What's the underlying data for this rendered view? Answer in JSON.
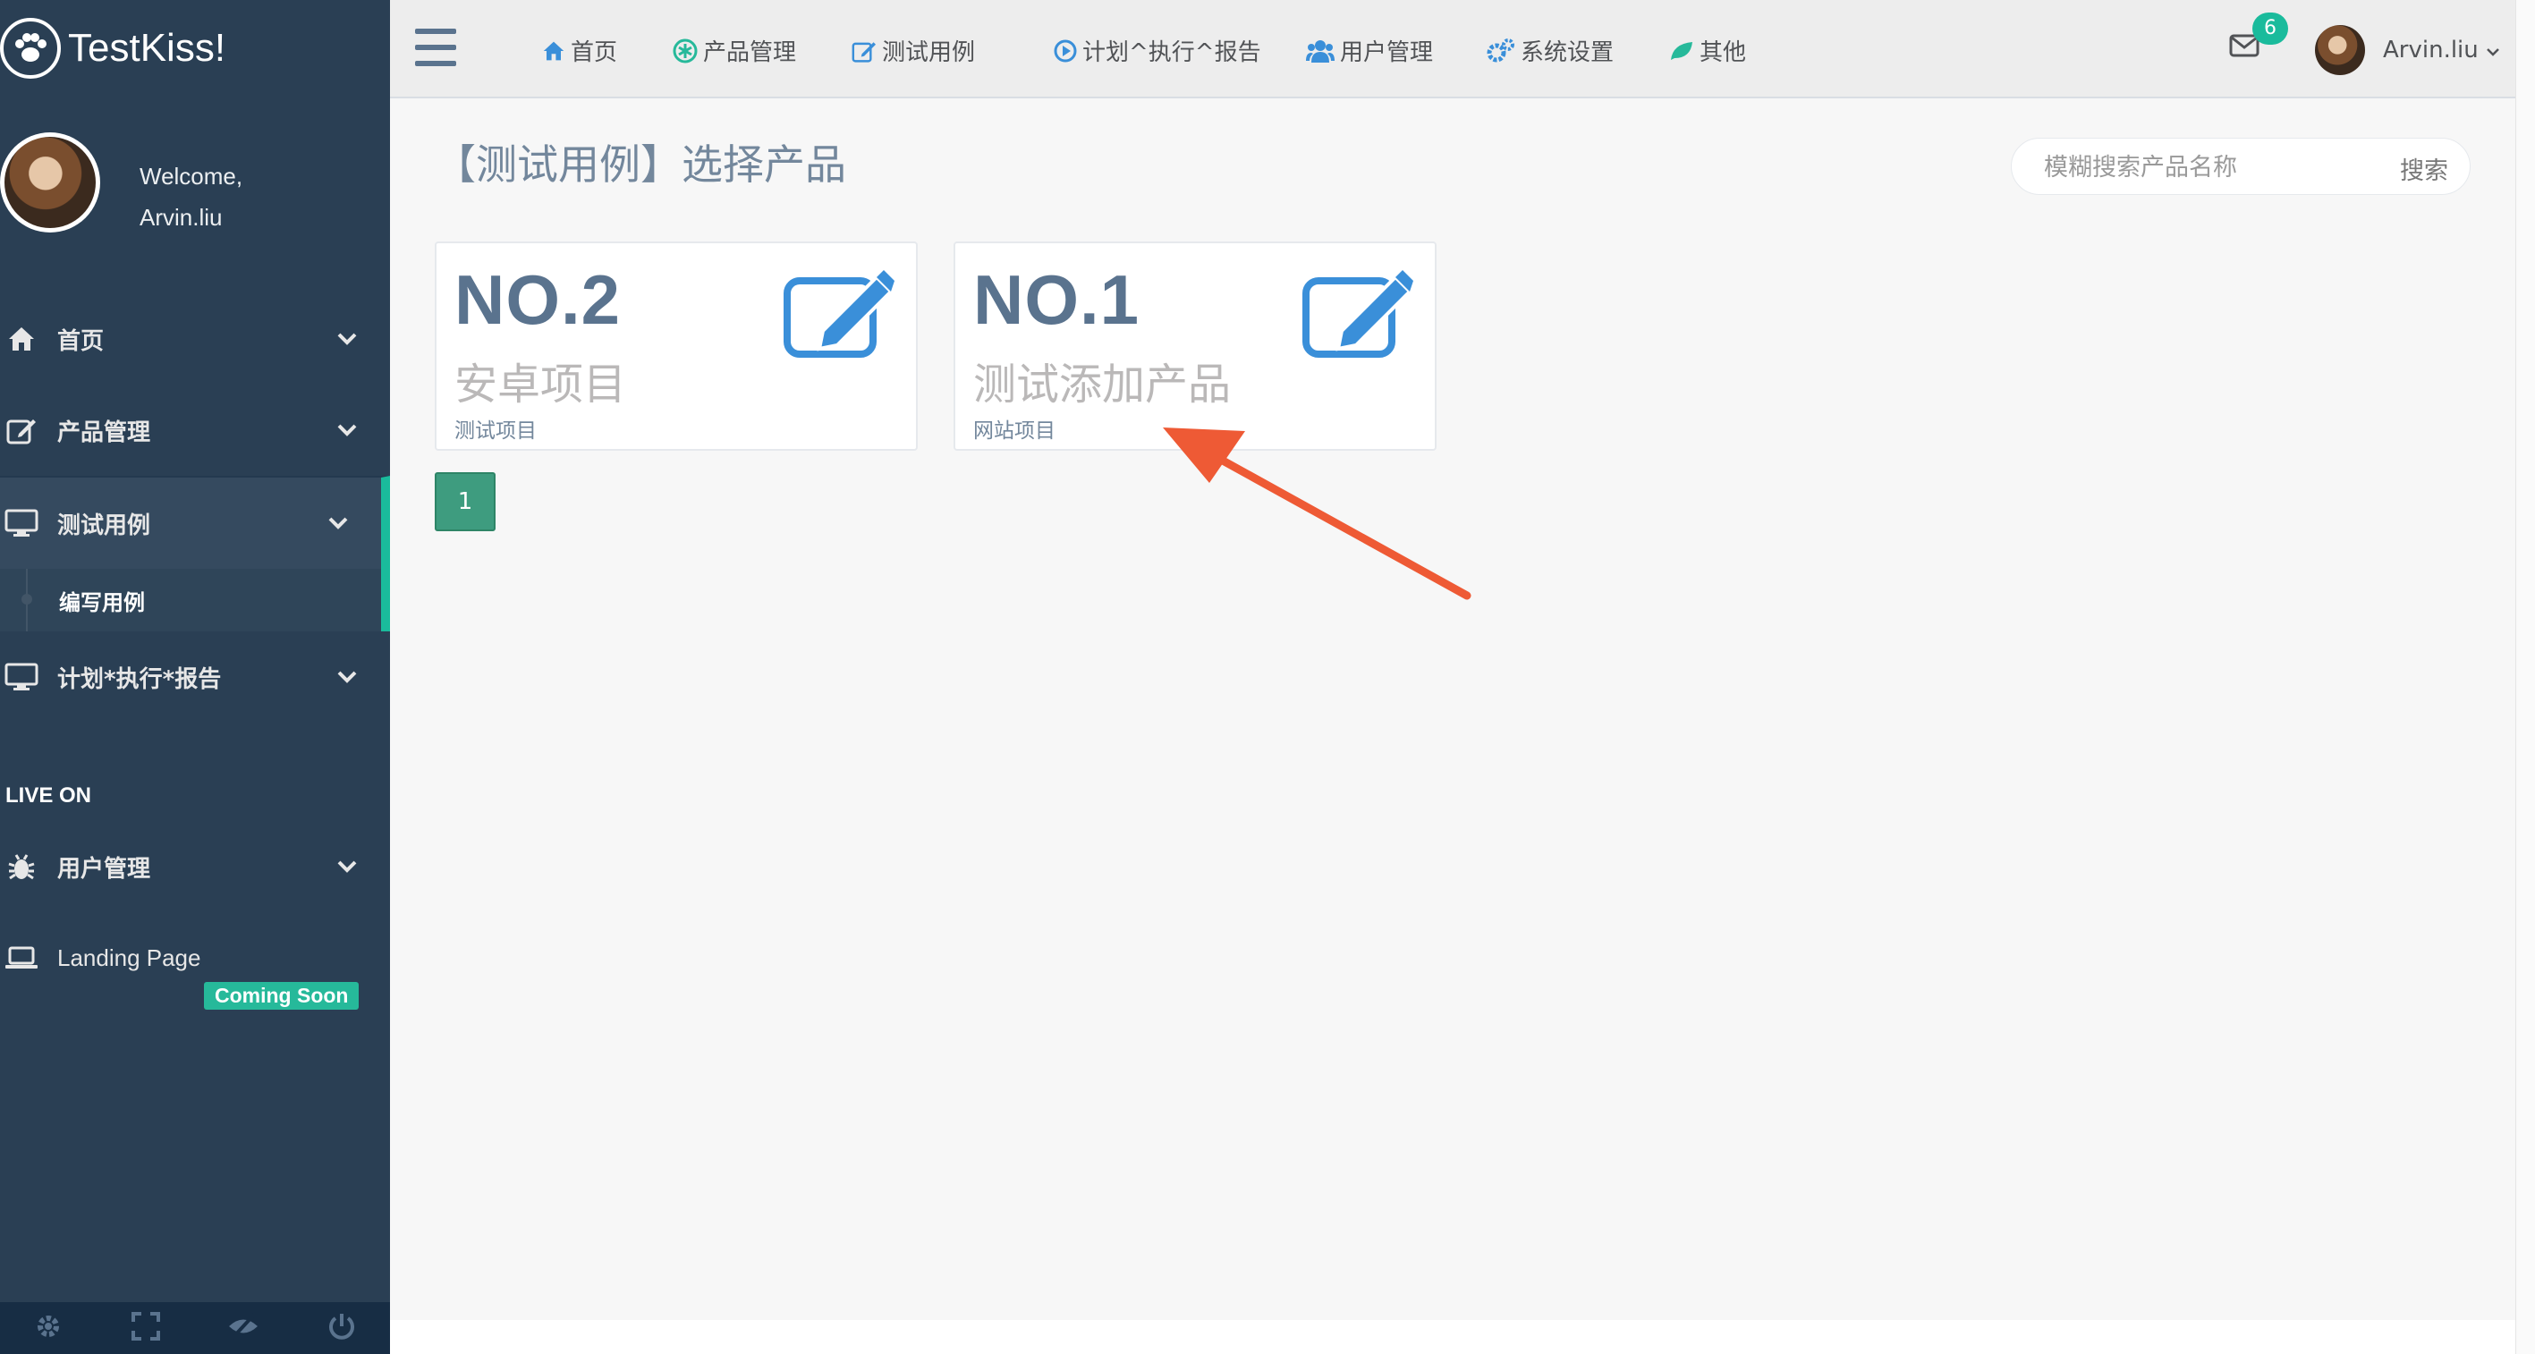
{
  "brand": {
    "name": "TestKiss!"
  },
  "profile": {
    "welcome": "Welcome,",
    "username": "Arvin.liu"
  },
  "sidebar": {
    "items": [
      {
        "label": "首页",
        "icon": "home-icon"
      },
      {
        "label": "产品管理",
        "icon": "edit-icon"
      },
      {
        "label": "测试用例",
        "icon": "desktop-icon",
        "active": true
      },
      {
        "label": "编写用例"
      },
      {
        "label": "计划*执行*报告",
        "icon": "desktop-icon"
      }
    ],
    "section_title": "LIVE ON",
    "items2": [
      {
        "label": "用户管理",
        "icon": "bug-icon"
      },
      {
        "label": "Landing Page",
        "icon": "laptop-icon",
        "badge": "Coming Soon"
      }
    ]
  },
  "topnav": {
    "items": [
      {
        "label": "首页",
        "icon": "home-icon"
      },
      {
        "label": "产品管理",
        "icon": "asterisk-icon"
      },
      {
        "label": "测试用例",
        "icon": "edit-icon"
      },
      {
        "label": "计划^执行^报告",
        "icon": "play-circle-icon"
      },
      {
        "label": "用户管理",
        "icon": "users-icon"
      },
      {
        "label": "系统设置",
        "icon": "cogs-icon"
      },
      {
        "label": "其他",
        "icon": "leaf-icon"
      }
    ],
    "mail_count": "6",
    "user": "Arvin.liu"
  },
  "main": {
    "title": "【测试用例】选择产品",
    "search": {
      "placeholder": "模糊搜索产品名称",
      "button": "搜索"
    },
    "cards": [
      {
        "count": "NO.2",
        "name": "安卓项目",
        "type": "测试项目"
      },
      {
        "count": "NO.1",
        "name": "测试添加产品",
        "type": "网站项目"
      }
    ],
    "pagination": {
      "current": "1"
    }
  },
  "colors": {
    "sidebar": "#2a3f54",
    "accent": "#1abb9c",
    "card_number": "#5a738e",
    "edit_icon": "#3a8fd9",
    "arrow": "#ee5a35"
  }
}
